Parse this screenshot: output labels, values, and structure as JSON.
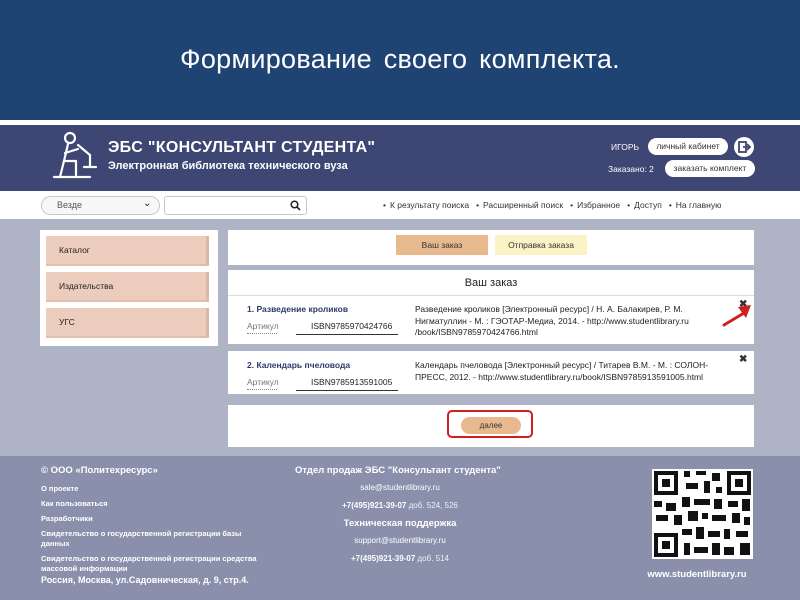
{
  "slide": {
    "title": "Формирование  своего  комплекта."
  },
  "header": {
    "brand_title": "ЭБС \"КОНСУЛЬТАНТ СТУДЕНТА\"",
    "brand_subtitle": "Электронная библиотека технического вуза",
    "user_name": "ИГОРЬ",
    "cabinet_label": "личный кабинет",
    "ordered_label": "Заказано:  2",
    "order_kit_label": "заказать комплект"
  },
  "search": {
    "scope_value": "Везде",
    "query_value": "",
    "nav_items": [
      "К результату поиска",
      "Расширенный поиск",
      "Избранное",
      "Доступ",
      "На главную"
    ]
  },
  "sidebar": {
    "items": [
      {
        "label": "Каталог"
      },
      {
        "label": "Издательства"
      },
      {
        "label": "УГС"
      }
    ]
  },
  "steps": {
    "your_order": "Ваш заказ",
    "send_order": "Отправка заказа"
  },
  "order": {
    "heading": "Ваш заказ",
    "items": [
      {
        "title": "1. Разведение кроликов",
        "article_label": "Артикул",
        "isbn": "ISBN9785970424766",
        "description": "Разведение кроликов [Электронный ресурс] / Н. А. Балакирев, Р. М. Нигматуллин - М. : ГЭОТАР-Медиа, 2014. - http://www.studentlibrary.ru /book/ISBN9785970424766.html"
      },
      {
        "title": "2. Календарь пчеловода",
        "article_label": "Артикул",
        "isbn": "ISBN9785913591005",
        "description": "Календарь пчеловода [Электронный ресурс] / Титарев В.М. - М. : СОЛОН-ПРЕСС, 2012. - http://www.studentlibrary.ru/book/ISBN9785913591005.html"
      }
    ],
    "next_label": "далее"
  },
  "footer": {
    "copyright": "© ООО «Политехресурс»",
    "links": [
      "О проекте",
      "Как пользоваться",
      "Разработчики",
      "Свидетельство о государственной регистрации базы данных",
      "Свидетельство о государственной регистрации средства массовой информации"
    ],
    "address": "Россия, Москва, ул.Садовническая, д. 9, стр.4.",
    "sales_title": "Отдел продаж ЭБС \"Консультант студента\"",
    "sales_email": "sale@studentlibrary.ru",
    "sales_phone": "+7(495)921-39-07",
    "sales_ext": " доб. 524, 526",
    "support_title": "Техническая поддержка",
    "support_email": "support@studentlibrary.ru",
    "support_phone": "+7(495)921-39-07",
    "support_ext": " доб. 514",
    "site_url": "www.studentlibrary.ru"
  },
  "colors": {
    "slide_bg": "#1f4473",
    "site_header_bg": "#3e4673",
    "active_step": "#e8b98f",
    "inactive_step": "#fbf3c5",
    "sidebar_item": "#ecccbc",
    "highlight_red": "#d11f1f",
    "footer_bg": "#8a90ac"
  }
}
